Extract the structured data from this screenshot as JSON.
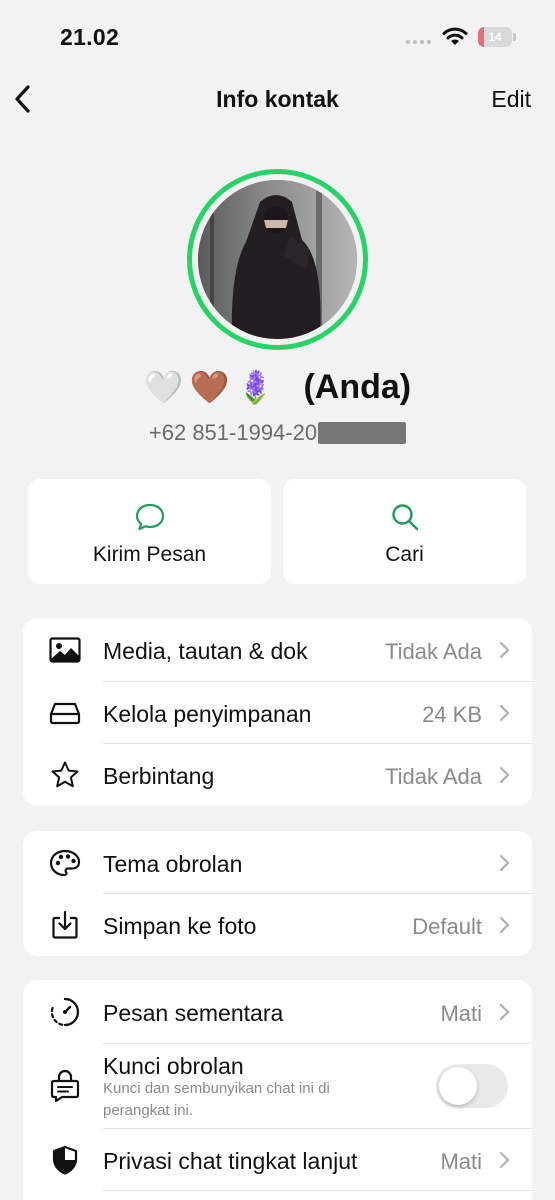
{
  "status": {
    "time": "21.02",
    "battery": "14",
    "battery_level": 0.14
  },
  "nav": {
    "title": "Info kontak",
    "edit_label": "Edit"
  },
  "profile": {
    "emojis": [
      "🤍",
      "🤎",
      "🪻"
    ],
    "name_suffix": "(Anda)",
    "phone": "+62 851-1994-20"
  },
  "actions": [
    {
      "label": "Kirim Pesan",
      "icon": "chat-bubble-icon"
    },
    {
      "label": "Cari",
      "icon": "search-icon"
    }
  ],
  "group1": [
    {
      "label": "Media, tautan & dok",
      "value": "Tidak Ada",
      "icon": "image-icon"
    },
    {
      "label": "Kelola penyimpanan",
      "value": "24 KB",
      "icon": "storage-icon"
    },
    {
      "label": "Berbintang",
      "value": "Tidak Ada",
      "icon": "star-icon"
    }
  ],
  "group2": [
    {
      "label": "Tema obrolan",
      "value": "",
      "icon": "palette-icon"
    },
    {
      "label": "Simpan ke foto",
      "value": "Default",
      "icon": "save-download-icon"
    }
  ],
  "group3": {
    "disappearing": {
      "label": "Pesan sementara",
      "value": "Mati",
      "icon": "timer-icon"
    },
    "chat_lock": {
      "label": "Kunci obrolan",
      "sub_line1": "Kunci dan sembunyikan chat ini di",
      "sub_line2": "perangkat ini.",
      "enabled": false,
      "icon": "lock-chat-icon"
    },
    "advanced_privacy": {
      "label": "Privasi chat tingkat lanjut",
      "value": "Mati",
      "icon": "shield-icon"
    }
  },
  "colors": {
    "accent": "#25d366",
    "icon_green": "#1f9e5b",
    "background": "#f2f2f2"
  }
}
